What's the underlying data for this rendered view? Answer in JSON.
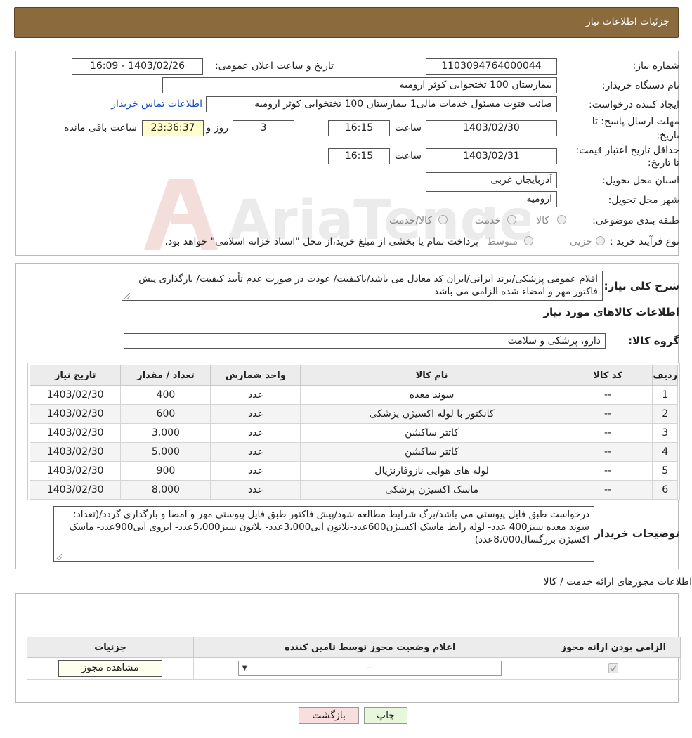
{
  "header": {
    "title": "جزئیات اطلاعات نیاز"
  },
  "form": {
    "need_number_label": "شماره نیاز:",
    "need_number": "1103094764000044",
    "announce_label": "تاریخ و ساعت اعلان عمومی:",
    "announce_value": "1403/02/26 - 16:09",
    "buyer_org_label": "نام دستگاه خریدار:",
    "buyer_org": "بیمارستان 100 تختخوابی کوثر ارومیه",
    "creator_label": "ایجاد کننده درخواست:",
    "creator": "صائب فتوت مسئول خدمات مالی1 بیمارستان 100 تختخوابی کوثر ارومیه",
    "contact_link": "اطلاعات تماس خریدار",
    "deadline_label": "مهلت ارسال پاسخ: تا تاریخ:",
    "deadline_date": "1403/02/30",
    "time_label": "ساعت",
    "deadline_time": "16:15",
    "days_value": "3",
    "days_label": "روز و",
    "remaining_value": "23:36:37",
    "remaining_label": "ساعت باقی مانده",
    "validity_label": "حداقل تاریخ اعتبار قیمت: تا تاریخ:",
    "validity_date": "1403/02/31",
    "validity_time": "16:15",
    "province_label": "استان محل تحویل:",
    "province": "آذربایجان غربی",
    "city_label": "شهر محل تحویل:",
    "city": "ارومیه",
    "category_label": "طبقه بندی موضوعی:",
    "category_options": [
      "کالا",
      "خدمت",
      "کالا/خدمت"
    ],
    "process_label": "نوع فرآیند خرید :",
    "process_options": [
      "جزیی",
      "متوسط"
    ],
    "process_note": "پرداخت تمام یا بخشی از مبلغ خرید،از محل \"اسناد خزانه اسلامی\" خواهد بود."
  },
  "description": {
    "label": "شرح کلی نیاز:",
    "text": "اقلام عمومی پزشکی/برند ایرانی/ایران کد معادل می باشد/باکیفیت/ عودت در صورت عدم تأیید کیفیت/ بارگذاری پیش فاکتور مهر و امضاء شده الزامی می باشد"
  },
  "goods": {
    "section_title": "اطلاعات کالاهای مورد نیاز",
    "group_label": "گروه کالا:",
    "group_value": "دارو، پزشکی و سلامت",
    "columns": [
      "ردیف",
      "کد کالا",
      "نام کالا",
      "واحد شمارش",
      "تعداد / مقدار",
      "تاریخ نیاز"
    ],
    "rows": [
      [
        "1",
        "--",
        "سوند معده",
        "عدد",
        "400",
        "1403/02/30"
      ],
      [
        "2",
        "--",
        "کانکتور با لوله اکسیژن پزشکی",
        "عدد",
        "600",
        "1403/02/30"
      ],
      [
        "3",
        "--",
        "کاتتر ساکشن",
        "عدد",
        "3,000",
        "1403/02/30"
      ],
      [
        "4",
        "--",
        "کاتتر ساکشن",
        "عدد",
        "5,000",
        "1403/02/30"
      ],
      [
        "5",
        "--",
        "لوله های هوایی نازوفارنژیال",
        "عدد",
        "900",
        "1403/02/30"
      ],
      [
        "6",
        "--",
        "ماسک اکسیژن پزشکی",
        "عدد",
        "8,000",
        "1403/02/30"
      ]
    ]
  },
  "buyer_notes": {
    "label": "توضیحات خریدار:",
    "text": "درخواست طبق فایل پیوستی می باشد/برگ شرایط مطالعه شود/پیش فاکتور طبق فایل پیوستی مهر و امضا و بارگذاری گردد/(تعداد: سوند معده سبز400 عدد- لوله رابط ماسک اکسیژن600عدد-نلاتون آبی3،000عدد- نلاتون سبز5،000عدد- ایروی آبی900عدد- ماسک اکسیژن بزرگسال8،000عدد)"
  },
  "permits": {
    "section_title": "اطلاعات مجوزهای ارائه خدمت / کالا",
    "columns": [
      "الزامی بودن ارائه مجوز",
      "اعلام وضعیت مجوز توسط تامین کننده",
      "جزئیات"
    ],
    "select_value": "--",
    "view_button": "مشاهده مجوز"
  },
  "footer": {
    "print_button": "چاپ",
    "back_button": "بازگشت"
  },
  "watermark": {
    "text": "AriaTender.neT"
  },
  "colors": {
    "header_bg": "#8b6a3e",
    "back_button_bg": "#f9dede",
    "print_button_bg": "#e6f7dc",
    "link": "#1b4fbd"
  }
}
